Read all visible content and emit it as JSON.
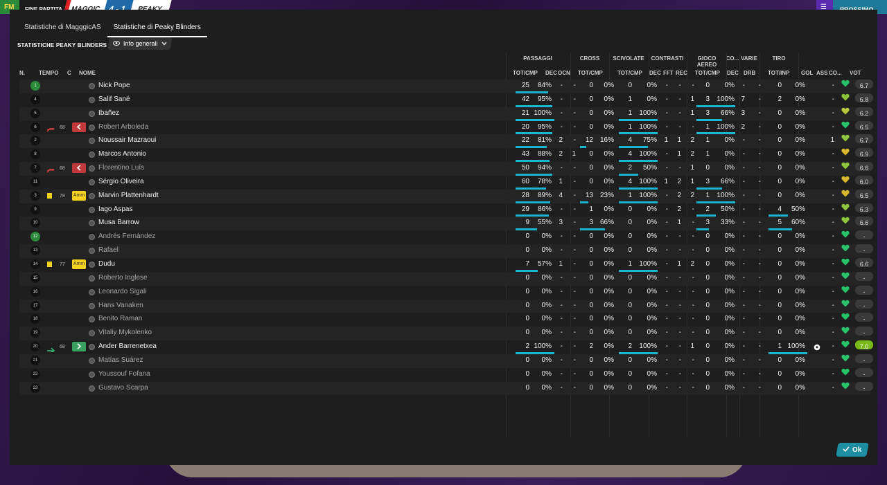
{
  "topbar": {
    "flag_label": "FM",
    "match_status": "FINE PARTITA",
    "home_team": "MAGGIC",
    "score": "4 - 1",
    "away_team": "PEAKY",
    "continue_label": "PROSSIMO"
  },
  "tabs": [
    "Statistiche di MagggicAS",
    "Statistiche di Peaky Blinders"
  ],
  "section_title": "STATISTICHE PEAKY BLINDERS",
  "view_select": "Info generali",
  "groups": {
    "passaggi": "PASSAGGI",
    "cross": "CROSS",
    "scivolate": "SCIVOLATE",
    "contrasti": "CONTRASTI",
    "gioco_aereo": "GIOCO AEREO",
    "co": "CO...",
    "varie": "VARIE",
    "tiro": "TIRO"
  },
  "columns": {
    "n": "N.",
    "tempo": "TEMPO",
    "c": "C",
    "nome": "NOME",
    "pass_tc": "TOT/CMP",
    "pass_dec": "DEC",
    "pass_ocn": "OCN",
    "cross_tc": "TOT/CMP",
    "sciv_tc": "TOT/CMP",
    "cont_dec": "DEC",
    "cont_fft": "FFT",
    "cont_rec": "REC",
    "aereo_tc": "TOT/CMP",
    "co_dec": "DEC",
    "varie_drb": "DRB",
    "tiro_ti": "TOT/INP",
    "gol": "GOL",
    "ass": "ASS",
    "co2": "CO...",
    "vot": "VOT"
  },
  "players": [
    {
      "n": "1",
      "gk": true,
      "tempo": "",
      "event": "",
      "badge": "",
      "name": "Nick Pope",
      "sub": false,
      "pt": "25",
      "pp": "84%",
      "pd": "-",
      "po": "-",
      "ct": "0",
      "cp": "0%",
      "st": "0",
      "sp": "0%",
      "kd": "-",
      "kf": "-",
      "kr": "-",
      "at": "0",
      "ap": "0%",
      "cd": "-",
      "dr": "-",
      "tt": "0",
      "tp": "0%",
      "gol": "",
      "ass": "-",
      "vote": "6.7",
      "heart": "#27c46a",
      "pb": 84,
      "cb": 0,
      "sb": 0,
      "ab": 0,
      "tb": 0
    },
    {
      "n": "4",
      "tempo": "",
      "event": "",
      "badge": "",
      "name": "Salif Sané",
      "sub": false,
      "pt": "42",
      "pp": "95%",
      "pd": "-",
      "po": "-",
      "ct": "0",
      "cp": "0%",
      "st": "1",
      "sp": "0%",
      "kd": "-",
      "kf": "-",
      "kr": "1",
      "at": "3",
      "ap": "100%",
      "cd": "7",
      "dr": "-",
      "tt": "2",
      "tp": "0%",
      "gol": "",
      "ass": "-",
      "vote": "6.8",
      "heart": "#8cc43a",
      "pb": 95,
      "cb": 0,
      "sb": 0,
      "ab": 100,
      "tb": 0
    },
    {
      "n": "5",
      "tempo": "",
      "event": "",
      "badge": "",
      "name": "Ibañez",
      "sub": false,
      "pt": "21",
      "pp": "100%",
      "pd": "-",
      "po": "-",
      "ct": "0",
      "cp": "0%",
      "st": "1",
      "sp": "100%",
      "kd": "-",
      "kf": "-",
      "kr": "1",
      "at": "3",
      "ap": "66%",
      "cd": "3",
      "dr": "-",
      "tt": "0",
      "tp": "0%",
      "gol": "",
      "ass": "-",
      "vote": "6.2",
      "heart": "#b8c43a",
      "pb": 100,
      "cb": 0,
      "sb": 100,
      "ab": 66,
      "tb": 0
    },
    {
      "n": "6",
      "tempo": "68",
      "event": "sub-out",
      "badge": "out",
      "name": "Robert Arboleda",
      "sub": true,
      "pt": "20",
      "pp": "95%",
      "pd": "-",
      "po": "-",
      "ct": "0",
      "cp": "0%",
      "st": "1",
      "sp": "100%",
      "kd": "-",
      "kf": "-",
      "kr": "-",
      "at": "1",
      "ap": "100%",
      "cd": "2",
      "dr": "-",
      "tt": "0",
      "tp": "0%",
      "gol": "",
      "ass": "-",
      "vote": "6.5",
      "heart": "#27c46a",
      "pb": 95,
      "cb": 0,
      "sb": 100,
      "ab": 100,
      "tb": 0
    },
    {
      "n": "2",
      "tempo": "",
      "event": "",
      "badge": "",
      "name": "Noussair Mazraoui",
      "sub": false,
      "pt": "22",
      "pp": "81%",
      "pd": "2",
      "po": "-",
      "ct": "12",
      "cp": "16%",
      "st": "4",
      "sp": "75%",
      "kd": "1",
      "kf": "1",
      "kr": "2",
      "at": "1",
      "ap": "0%",
      "cd": "-",
      "dr": "-",
      "tt": "0",
      "tp": "0%",
      "gol": "",
      "ass": "1",
      "vote": "6.7",
      "heart": "#8cc43a",
      "pb": 81,
      "cb": 16,
      "sb": 75,
      "ab": 0,
      "tb": 0
    },
    {
      "n": "8",
      "tempo": "",
      "event": "",
      "badge": "",
      "name": "Marcos Antonio",
      "sub": false,
      "pt": "43",
      "pp": "88%",
      "pd": "2",
      "po": "1",
      "ct": "0",
      "cp": "0%",
      "st": "4",
      "sp": "100%",
      "kd": "-",
      "kf": "1",
      "kr": "2",
      "at": "1",
      "ap": "0%",
      "cd": "-",
      "dr": "-",
      "tt": "0",
      "tp": "0%",
      "gol": "",
      "ass": "-",
      "vote": "6.9",
      "heart": "#d8b82a",
      "pb": 88,
      "cb": 0,
      "sb": 100,
      "ab": 0,
      "tb": 0
    },
    {
      "n": "7",
      "tempo": "68",
      "event": "sub-out",
      "badge": "out",
      "name": "Florentino Luís",
      "sub": true,
      "pt": "50",
      "pp": "94%",
      "pd": "-",
      "po": "-",
      "ct": "0",
      "cp": "0%",
      "st": "2",
      "sp": "50%",
      "kd": "-",
      "kf": "-",
      "kr": "1",
      "at": "0",
      "ap": "0%",
      "cd": "-",
      "dr": "-",
      "tt": "0",
      "tp": "0%",
      "gol": "",
      "ass": "-",
      "vote": "6.6",
      "heart": "#8cc43a",
      "pb": 94,
      "cb": 0,
      "sb": 50,
      "ab": 0,
      "tb": 0
    },
    {
      "n": "11",
      "tempo": "",
      "event": "",
      "badge": "",
      "name": "Sérgio Oliveira",
      "sub": false,
      "pt": "60",
      "pp": "78%",
      "pd": "1",
      "po": "-",
      "ct": "0",
      "cp": "0%",
      "st": "4",
      "sp": "100%",
      "kd": "1",
      "kf": "2",
      "kr": "1",
      "at": "3",
      "ap": "66%",
      "cd": "-",
      "dr": "-",
      "tt": "0",
      "tp": "0%",
      "gol": "",
      "ass": "-",
      "vote": "6.0",
      "heart": "#d8b82a",
      "pb": 78,
      "cb": 0,
      "sb": 100,
      "ab": 66,
      "tb": 0
    },
    {
      "n": "3",
      "tempo": "78",
      "event": "yellow",
      "badge": "amm",
      "badge_label": "Amm",
      "name": "Marvin Plattenhardt",
      "sub": false,
      "pt": "28",
      "pp": "89%",
      "pd": "4",
      "po": "-",
      "ct": "13",
      "cp": "23%",
      "st": "1",
      "sp": "100%",
      "kd": "-",
      "kf": "2",
      "kr": "2",
      "at": "1",
      "ap": "100%",
      "cd": "-",
      "dr": "-",
      "tt": "0",
      "tp": "0%",
      "gol": "",
      "ass": "-",
      "vote": "6.5",
      "heart": "#d8b82a",
      "pb": 89,
      "cb": 23,
      "sb": 100,
      "ab": 100,
      "tb": 0
    },
    {
      "n": "9",
      "tempo": "",
      "event": "",
      "badge": "",
      "name": "Iago Aspas",
      "sub": false,
      "pt": "29",
      "pp": "86%",
      "pd": "-",
      "po": "-",
      "ct": "1",
      "cp": "0%",
      "st": "0",
      "sp": "0%",
      "kd": "-",
      "kf": "2",
      "kr": "-",
      "at": "2",
      "ap": "50%",
      "cd": "-",
      "dr": "-",
      "tt": "4",
      "tp": "50%",
      "gol": "",
      "ass": "-",
      "vote": "6.3",
      "heart": "#8cc43a",
      "pb": 86,
      "cb": 0,
      "sb": 0,
      "ab": 50,
      "tb": 50
    },
    {
      "n": "10",
      "tempo": "",
      "event": "",
      "badge": "",
      "name": "Musa Barrow",
      "sub": false,
      "pt": "9",
      "pp": "55%",
      "pd": "3",
      "po": "-",
      "ct": "3",
      "cp": "66%",
      "st": "0",
      "sp": "0%",
      "kd": "-",
      "kf": "1",
      "kr": "-",
      "at": "3",
      "ap": "33%",
      "cd": "-",
      "dr": "-",
      "tt": "5",
      "tp": "60%",
      "gol": "",
      "ass": "-",
      "vote": "6.6",
      "heart": "#8cc43a",
      "pb": 55,
      "cb": 66,
      "sb": 0,
      "ab": 33,
      "tb": 60
    },
    {
      "n": "12",
      "gk": true,
      "tempo": "",
      "event": "",
      "badge": "",
      "name": "Andrés Fernández",
      "sub": true,
      "pt": "0",
      "pp": "0%",
      "pd": "-",
      "po": "-",
      "ct": "0",
      "cp": "0%",
      "st": "0",
      "sp": "0%",
      "kd": "-",
      "kf": "-",
      "kr": "-",
      "at": "0",
      "ap": "0%",
      "cd": "-",
      "dr": "-",
      "tt": "0",
      "tp": "0%",
      "gol": "",
      "ass": "-",
      "vote": "-",
      "heart": "#27c46a",
      "pb": 0,
      "cb": 0,
      "sb": 0,
      "ab": 0,
      "tb": 0
    },
    {
      "n": "13",
      "tempo": "",
      "event": "",
      "badge": "",
      "name": "Rafael",
      "sub": true,
      "pt": "0",
      "pp": "0%",
      "pd": "-",
      "po": "-",
      "ct": "0",
      "cp": "0%",
      "st": "0",
      "sp": "0%",
      "kd": "-",
      "kf": "-",
      "kr": "-",
      "at": "0",
      "ap": "0%",
      "cd": "-",
      "dr": "-",
      "tt": "0",
      "tp": "0%",
      "gol": "",
      "ass": "-",
      "vote": "-",
      "heart": "#27c46a",
      "pb": 0,
      "cb": 0,
      "sb": 0,
      "ab": 0,
      "tb": 0
    },
    {
      "n": "14",
      "tempo": "77",
      "event": "yellow",
      "badge": "amm",
      "badge_label": "Amm",
      "name": "Dudu",
      "sub": false,
      "pt": "7",
      "pp": "57%",
      "pd": "1",
      "po": "-",
      "ct": "0",
      "cp": "0%",
      "st": "1",
      "sp": "100%",
      "kd": "-",
      "kf": "1",
      "kr": "2",
      "at": "0",
      "ap": "0%",
      "cd": "-",
      "dr": "-",
      "tt": "0",
      "tp": "0%",
      "gol": "",
      "ass": "-",
      "vote": "6.6",
      "heart": "#27c46a",
      "pb": 57,
      "cb": 0,
      "sb": 100,
      "ab": 0,
      "tb": 0
    },
    {
      "n": "15",
      "tempo": "",
      "event": "",
      "badge": "",
      "name": "Roberto Inglese",
      "sub": true,
      "pt": "0",
      "pp": "0%",
      "pd": "-",
      "po": "-",
      "ct": "0",
      "cp": "0%",
      "st": "0",
      "sp": "0%",
      "kd": "-",
      "kf": "-",
      "kr": "-",
      "at": "0",
      "ap": "0%",
      "cd": "-",
      "dr": "-",
      "tt": "0",
      "tp": "0%",
      "gol": "",
      "ass": "-",
      "vote": "-",
      "heart": "#27c46a",
      "pb": 0,
      "cb": 0,
      "sb": 0,
      "ab": 0,
      "tb": 0
    },
    {
      "n": "16",
      "tempo": "",
      "event": "",
      "badge": "",
      "name": "Leonardo Sigali",
      "sub": true,
      "pt": "0",
      "pp": "0%",
      "pd": "-",
      "po": "-",
      "ct": "0",
      "cp": "0%",
      "st": "0",
      "sp": "0%",
      "kd": "-",
      "kf": "-",
      "kr": "-",
      "at": "0",
      "ap": "0%",
      "cd": "-",
      "dr": "-",
      "tt": "0",
      "tp": "0%",
      "gol": "",
      "ass": "-",
      "vote": "-",
      "heart": "#27c46a",
      "pb": 0,
      "cb": 0,
      "sb": 0,
      "ab": 0,
      "tb": 0
    },
    {
      "n": "17",
      "tempo": "",
      "event": "",
      "badge": "",
      "name": "Hans Vanaken",
      "sub": true,
      "pt": "0",
      "pp": "0%",
      "pd": "-",
      "po": "-",
      "ct": "0",
      "cp": "0%",
      "st": "0",
      "sp": "0%",
      "kd": "-",
      "kf": "-",
      "kr": "-",
      "at": "0",
      "ap": "0%",
      "cd": "-",
      "dr": "-",
      "tt": "0",
      "tp": "0%",
      "gol": "",
      "ass": "-",
      "vote": "-",
      "heart": "#27c46a",
      "pb": 0,
      "cb": 0,
      "sb": 0,
      "ab": 0,
      "tb": 0
    },
    {
      "n": "18",
      "tempo": "",
      "event": "",
      "badge": "",
      "name": "Benito Raman",
      "sub": true,
      "pt": "0",
      "pp": "0%",
      "pd": "-",
      "po": "-",
      "ct": "0",
      "cp": "0%",
      "st": "0",
      "sp": "0%",
      "kd": "-",
      "kf": "-",
      "kr": "-",
      "at": "0",
      "ap": "0%",
      "cd": "-",
      "dr": "-",
      "tt": "0",
      "tp": "0%",
      "gol": "",
      "ass": "-",
      "vote": "-",
      "heart": "#27c46a",
      "pb": 0,
      "cb": 0,
      "sb": 0,
      "ab": 0,
      "tb": 0
    },
    {
      "n": "19",
      "tempo": "",
      "event": "",
      "badge": "",
      "name": "Vitaliy Mykolenko",
      "sub": true,
      "pt": "0",
      "pp": "0%",
      "pd": "-",
      "po": "-",
      "ct": "0",
      "cp": "0%",
      "st": "0",
      "sp": "0%",
      "kd": "-",
      "kf": "-",
      "kr": "-",
      "at": "0",
      "ap": "0%",
      "cd": "-",
      "dr": "-",
      "tt": "0",
      "tp": "0%",
      "gol": "",
      "ass": "-",
      "vote": "-",
      "heart": "#27c46a",
      "pb": 0,
      "cb": 0,
      "sb": 0,
      "ab": 0,
      "tb": 0
    },
    {
      "n": "20",
      "tempo": "68",
      "event": "sub-in",
      "badge": "in",
      "name": "Ander Barrenetxea",
      "sub": false,
      "pt": "2",
      "pp": "100%",
      "pd": "-",
      "po": "-",
      "ct": "2",
      "cp": "0%",
      "st": "2",
      "sp": "100%",
      "kd": "-",
      "kf": "-",
      "kr": "1",
      "at": "0",
      "ap": "0%",
      "cd": "-",
      "dr": "-",
      "tt": "1",
      "tp": "100%",
      "gol": "ball",
      "ass": "-",
      "vote": "7.0",
      "best": true,
      "heart": "#27c46a",
      "pb": 100,
      "cb": 0,
      "sb": 100,
      "ab": 0,
      "tb": 100
    },
    {
      "n": "21",
      "tempo": "",
      "event": "",
      "badge": "",
      "name": "Matías Suárez",
      "sub": true,
      "pt": "0",
      "pp": "0%",
      "pd": "-",
      "po": "-",
      "ct": "0",
      "cp": "0%",
      "st": "0",
      "sp": "0%",
      "kd": "-",
      "kf": "-",
      "kr": "-",
      "at": "0",
      "ap": "0%",
      "cd": "-",
      "dr": "-",
      "tt": "0",
      "tp": "0%",
      "gol": "",
      "ass": "-",
      "vote": "-",
      "heart": "#27c46a",
      "pb": 0,
      "cb": 0,
      "sb": 0,
      "ab": 0,
      "tb": 0
    },
    {
      "n": "22",
      "tempo": "",
      "event": "",
      "badge": "",
      "name": "Youssouf Fofana",
      "sub": true,
      "pt": "0",
      "pp": "0%",
      "pd": "-",
      "po": "-",
      "ct": "0",
      "cp": "0%",
      "st": "0",
      "sp": "0%",
      "kd": "-",
      "kf": "-",
      "kr": "-",
      "at": "0",
      "ap": "0%",
      "cd": "-",
      "dr": "-",
      "tt": "0",
      "tp": "0%",
      "gol": "",
      "ass": "-",
      "vote": "-",
      "heart": "#27c46a",
      "pb": 0,
      "cb": 0,
      "sb": 0,
      "ab": 0,
      "tb": 0
    },
    {
      "n": "23",
      "tempo": "",
      "event": "",
      "badge": "",
      "name": "Gustavo Scarpa",
      "sub": true,
      "pt": "0",
      "pp": "0%",
      "pd": "-",
      "po": "-",
      "ct": "0",
      "cp": "0%",
      "st": "0",
      "sp": "0%",
      "kd": "-",
      "kf": "-",
      "kr": "-",
      "at": "0",
      "ap": "0%",
      "cd": "-",
      "dr": "-",
      "tt": "0",
      "tp": "0%",
      "gol": "",
      "ass": "-",
      "vote": "-",
      "heart": "#27c46a",
      "pb": 0,
      "cb": 0,
      "sb": 0,
      "ab": 0,
      "tb": 0
    }
  ],
  "ok_label": "Ok",
  "colors": {
    "accent": "#17b8cf",
    "best_vote": "#7ab818",
    "sub_out": "#c0393b",
    "sub_in": "#3aa060",
    "yellow": "#f2d21e"
  }
}
